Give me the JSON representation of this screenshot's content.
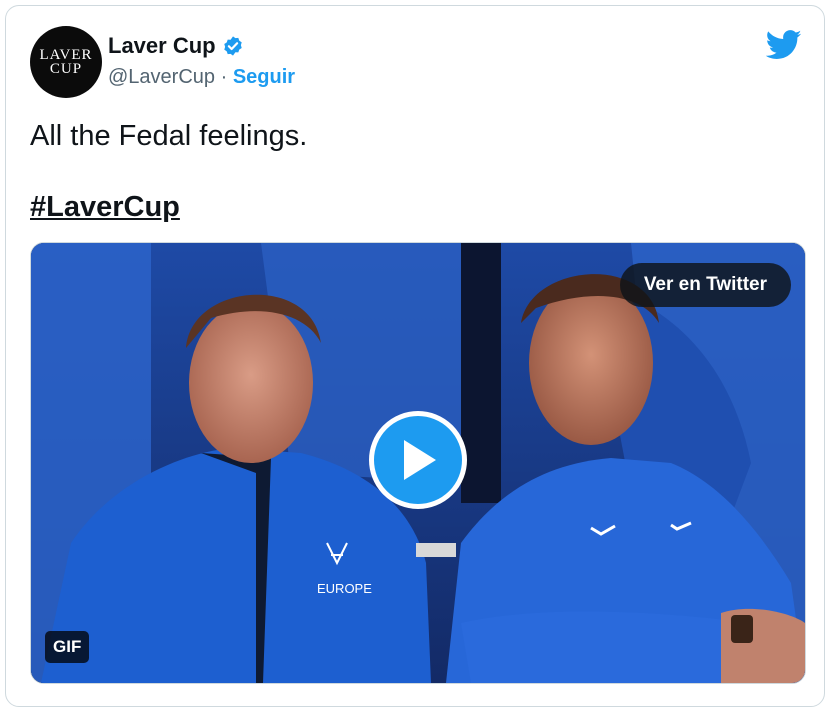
{
  "author": {
    "display_name": "Laver Cup",
    "handle": "@LaverCup",
    "separator": "·",
    "follow_label": "Seguir",
    "avatar_line1": "LAVER",
    "avatar_line2": "CUP"
  },
  "tweet": {
    "text": "All the Fedal feelings.",
    "hashtag": "#LaverCup"
  },
  "media": {
    "view_button_label": "Ver en Twitter",
    "gif_badge": "GIF",
    "jacket_logo_text": "EUROPE"
  },
  "icons": {
    "verified": "verified-badge-icon",
    "brand": "twitter-bird-icon",
    "play": "play-icon"
  },
  "colors": {
    "accent": "#1d9bf0",
    "text": "#0f1419",
    "muted": "#536471"
  }
}
